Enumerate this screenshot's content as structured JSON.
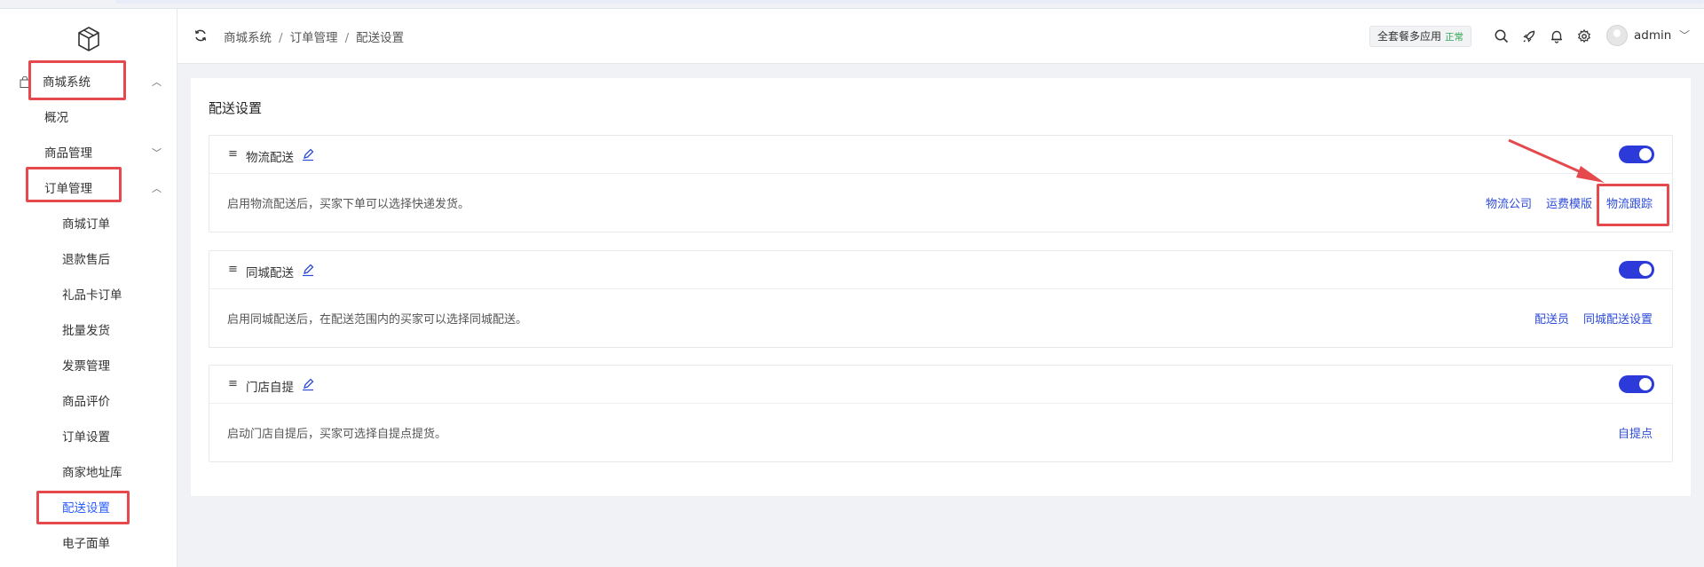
{
  "sidebar": {
    "logo": "cube-logo",
    "items": [
      {
        "label": "商城系统",
        "chevron": "^"
      },
      {
        "label": "概况"
      },
      {
        "label": "商品管理",
        "chevron": "v"
      },
      {
        "label": "订单管理",
        "chevron": "^"
      },
      {
        "label": "商城订单"
      },
      {
        "label": "退款售后"
      },
      {
        "label": "礼品卡订单"
      },
      {
        "label": "批量发货"
      },
      {
        "label": "发票管理"
      },
      {
        "label": "商品评价"
      },
      {
        "label": "订单设置"
      },
      {
        "label": "商家地址库"
      },
      {
        "label": "配送设置"
      },
      {
        "label": "电子面单"
      }
    ]
  },
  "header": {
    "breadcrumb": [
      "商城系统",
      "订单管理",
      "配送设置"
    ],
    "separator": "/",
    "package_badge": "全套餐多应用",
    "package_status": "正常",
    "user": "admin",
    "icons": [
      "search-icon",
      "rocket-icon",
      "bell-icon",
      "gear-icon"
    ]
  },
  "page": {
    "title": "配送设置",
    "cards": [
      {
        "title": "物流配送",
        "enabled": true,
        "description": "启用物流配送后，买家下单可以选择快递发货。",
        "links": [
          "物流公司",
          "运费模版",
          "物流跟踪"
        ]
      },
      {
        "title": "同城配送",
        "enabled": true,
        "description": "启用同城配送后，在配送范围内的买家可以选择同城配送。",
        "links": [
          "配送员",
          "同城配送设置"
        ]
      },
      {
        "title": "门店自提",
        "enabled": true,
        "description": "启动门店自提后，买家可选择自提点提货。",
        "links": [
          "自提点"
        ]
      }
    ]
  },
  "colors": {
    "accent": "#2b3ad8",
    "link": "#2b4ad8",
    "highlight": "#e5484d",
    "status_ok": "#34a853"
  }
}
